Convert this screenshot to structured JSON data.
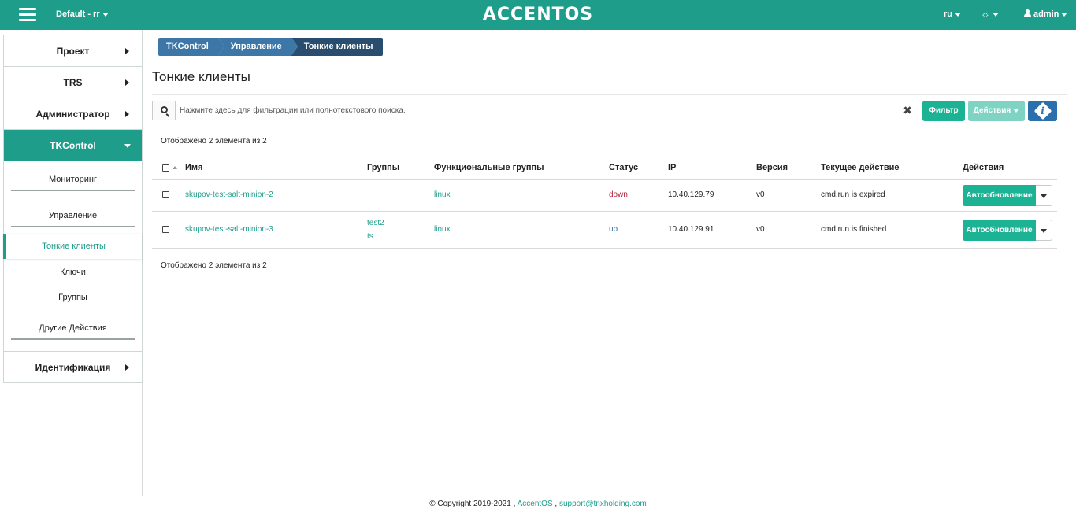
{
  "header": {
    "project": "Default - rr",
    "brand": "ACCENTOS",
    "lang": "ru",
    "user": "admin"
  },
  "sidebar": {
    "items": [
      {
        "label": "Проект"
      },
      {
        "label": "TRS"
      },
      {
        "label": "Администратор"
      },
      {
        "label": "TKControl"
      },
      {
        "label": "Идентификация"
      }
    ],
    "sub": {
      "monitoring": "Мониторинг",
      "management": "Управление",
      "thin_clients": "Тонкие клиенты",
      "keys": "Ключи",
      "groups": "Группы",
      "other": "Другие Действия"
    }
  },
  "breadcrumb": [
    "TKControl",
    "Управление",
    "Тонкие клиенты"
  ],
  "page_title": "Тонкие клиенты",
  "search": {
    "placeholder": "Нажмите здесь для фильтрации или полнотекстового поиска.",
    "value": ""
  },
  "buttons": {
    "filter": "Фильтр",
    "actions": "Действия"
  },
  "count_text": "Отображено 2 элемента из 2",
  "table": {
    "columns": {
      "name": "Имя",
      "groups": "Группы",
      "func_groups": "Функциональные группы",
      "status": "Статус",
      "ip": "IP",
      "version": "Версия",
      "current_action": "Текущее действие",
      "actions": "Действия"
    },
    "rows": [
      {
        "name": "skupov-test-salt-minion-2",
        "groups": [
          "",
          ""
        ],
        "func_group": "linux",
        "status": "down",
        "ip": "10.40.129.79",
        "version": "v0",
        "current_action": "cmd.run is expired",
        "action_button": "Автообновление"
      },
      {
        "name": "skupov-test-salt-minion-3",
        "groups": [
          "test2",
          "ts"
        ],
        "func_group": "linux",
        "status": "up",
        "ip": "10.40.129.91",
        "version": "v0",
        "current_action": "cmd.run is finished",
        "action_button": "Автообновление"
      }
    ]
  },
  "footer": {
    "copyright": "© Copyright 2019-2021 ,",
    "link1": "AccentOS",
    "sep": ",",
    "link2": "support@tnxholding.com"
  },
  "colors": {
    "primary": "#1e9e8a",
    "button_green": "#1bb394",
    "info_blue": "#2b6fad",
    "status_down": "#b0233a",
    "status_up": "#2b6fad"
  }
}
